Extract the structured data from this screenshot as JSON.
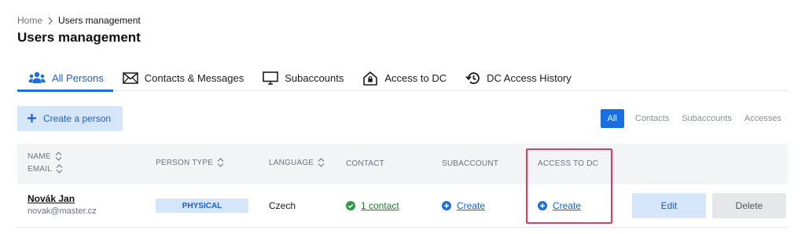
{
  "breadcrumb": {
    "home": "Home",
    "current": "Users management"
  },
  "page_title": "Users management",
  "tabs": [
    {
      "label": "All Persons",
      "icon": "persons-icon",
      "active": true
    },
    {
      "label": "Contacts & Messages",
      "icon": "envelope-icon",
      "active": false
    },
    {
      "label": "Subaccounts",
      "icon": "monitor-icon",
      "active": false
    },
    {
      "label": "Access to DC",
      "icon": "house-lock-icon",
      "active": false
    },
    {
      "label": "DC Access History",
      "icon": "history-icon",
      "active": false
    }
  ],
  "create_button": {
    "label": "Create a person",
    "icon": "plus-icon"
  },
  "filters": [
    {
      "label": "All",
      "active": true
    },
    {
      "label": "Contacts",
      "active": false
    },
    {
      "label": "Subaccounts",
      "active": false
    },
    {
      "label": "Accesses",
      "active": false
    }
  ],
  "table": {
    "headers": {
      "name": "NAME",
      "email": "EMAIL",
      "person_type": "PERSON TYPE",
      "language": "LANGUAGE",
      "contact": "CONTACT",
      "subaccount": "SUBACCOUNT",
      "access_to_dc": "ACCESS TO DC"
    },
    "rows": [
      {
        "name": "Novák Jan",
        "email": "novak@master.cz",
        "person_type": "PHYSICAL",
        "language": "Czech",
        "contact": "1 contact",
        "subaccount": "Create",
        "access_to_dc": "Create",
        "edit": "Edit",
        "delete": "Delete"
      }
    ]
  },
  "colors": {
    "accent": "#1a6fe0",
    "accent_light": "#d5e6fa",
    "success": "#2e9a3e",
    "highlight": "#e8375f"
  }
}
